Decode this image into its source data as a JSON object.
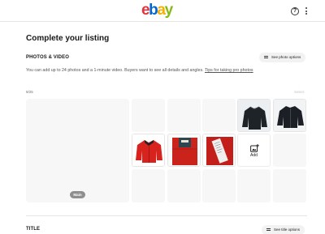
{
  "header": {
    "logo": "ebay"
  },
  "page": {
    "title": "Complete your listing"
  },
  "photos": {
    "label": "PHOTOS & VIDEO",
    "options_button": "See photo options",
    "helper_text": "You can add up to 24 photos and a 1-minute video. Buyers want to see all details and angles.",
    "helper_link": "Tips for taking pro photos",
    "count": "9/25",
    "select_label": "Select",
    "main_badge": "Main",
    "add_label": "Add"
  },
  "title_section": {
    "label": "TITLE",
    "options_button": "See title options"
  },
  "colors": {
    "jacket_black": "#1e2328",
    "jacket_red": "#d8221d",
    "tile_bg": "#f7f7f7"
  }
}
